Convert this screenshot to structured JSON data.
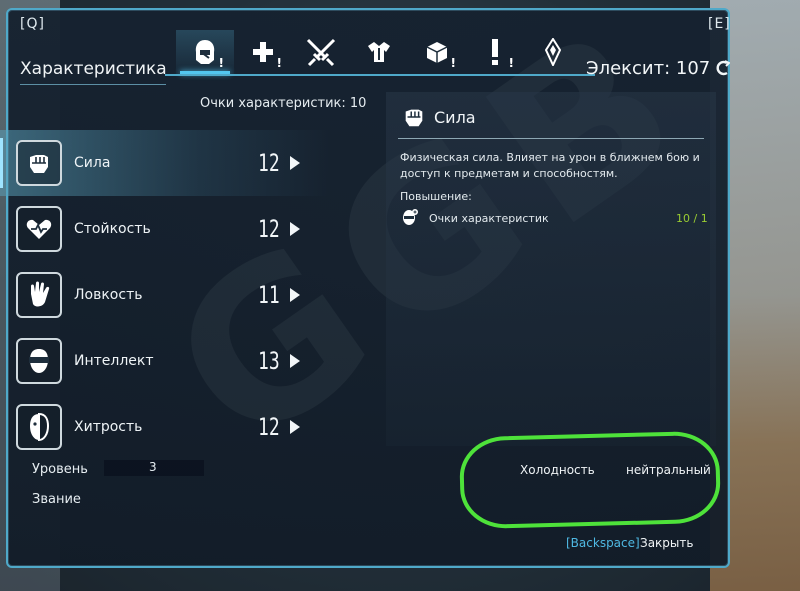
{
  "keys": {
    "prev": "[Q]",
    "next": "[E]"
  },
  "tabs": [
    {
      "name": "character",
      "icon": "hooded-head-icon",
      "badge": "!",
      "active": true
    },
    {
      "name": "health",
      "icon": "plus-icon",
      "badge": "!",
      "active": false
    },
    {
      "name": "weapons",
      "icon": "crossed-swords-icon",
      "badge": "",
      "active": false
    },
    {
      "name": "armor",
      "icon": "armor-icon",
      "badge": "",
      "active": false
    },
    {
      "name": "items",
      "icon": "cube-icon",
      "badge": "!",
      "active": false
    },
    {
      "name": "quests",
      "icon": "exclamation-icon",
      "badge": "!",
      "active": false
    },
    {
      "name": "map",
      "icon": "crystal-icon",
      "badge": "",
      "active": false
    }
  ],
  "header": {
    "title": "Характеристика",
    "elexit": "Элексит: 107",
    "points": "Очки характеристик: 10"
  },
  "stats": [
    {
      "label": "Сила",
      "value": "12",
      "icon": "fist-icon",
      "selected": true
    },
    {
      "label": "Стойкость",
      "value": "12",
      "icon": "heart-shield-icon",
      "selected": false
    },
    {
      "label": "Ловкость",
      "value": "11",
      "icon": "hand-icon",
      "selected": false
    },
    {
      "label": "Интеллект",
      "value": "13",
      "icon": "head-visor-icon",
      "selected": false
    },
    {
      "label": "Хитрость",
      "value": "12",
      "icon": "two-face-icon",
      "selected": false
    }
  ],
  "info": {
    "level_label": "Уровень",
    "level_value": "3",
    "rank_label": "Звание"
  },
  "detail": {
    "title": "Сила",
    "description": "Физическая сила. Влияет на урон в ближнем бою и доступ к предметам и способностям.",
    "requirements_heading": "Повышение:",
    "requirement_label": "Очки характеристик",
    "requirement_value": "10 / 1"
  },
  "temperament": {
    "label": "Холодность",
    "value": "нейтральный"
  },
  "footer": {
    "close_key": "[Backspace]",
    "close_label": "Закрыть"
  },
  "colors": {
    "accent": "#4fa9c9",
    "highlight_circle": "#4ee23a",
    "requirement_value": "#9acd32",
    "key_hint": "#4fb8e2"
  }
}
